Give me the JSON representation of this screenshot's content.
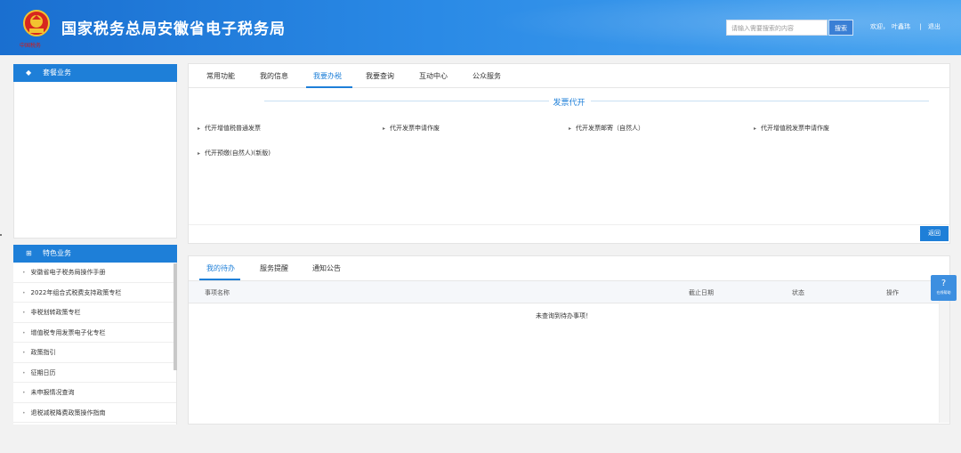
{
  "header": {
    "title": "国家税务总局安徽省电子税务局",
    "emblem_caption": "中国税务",
    "search_placeholder": "请输入需要搜索的内容",
    "search_button": "搜索",
    "welcome": "欢迎，",
    "user_name": "叶鑫玮",
    "separator": "|",
    "logout": "退出",
    "colors": {
      "brand": "#1e7fd8",
      "header_start": "#1a6fd0",
      "header_end": "#4aa5f0"
    }
  },
  "sidebar": {
    "package_title": "套餐业务",
    "package_icon": "layers-icon",
    "featured_title": "特色业务",
    "featured_icon": "grid-icon",
    "featured_items": [
      "安徽省电子税务局操作手册",
      "2022年组合式税费支持政策专栏",
      "非税划转政策专栏",
      "增值税专用发票电子化专栏",
      "政策指引",
      "征期日历",
      "未申报情况查询",
      "退税减税降费政策操作指南"
    ]
  },
  "main": {
    "tabs": [
      "常用功能",
      "我的信息",
      "我要办税",
      "我要查询",
      "互动中心",
      "公众服务"
    ],
    "active_tab": "我要办税",
    "section_title": "发票代开",
    "invoice_links": [
      "代开增值税普通发票",
      "代开发票申请作废",
      "代开发票邮寄（自然人）",
      "代开增值税发票申请作废",
      "代开预缴(自然人)(新版)"
    ],
    "return_button": "返回"
  },
  "todo": {
    "tabs": [
      "我的待办",
      "服务提醒",
      "通知公告"
    ],
    "active_tab": "我的待办",
    "columns": [
      "事项名称",
      "截止日期",
      "状态",
      "操作"
    ],
    "empty_message": "未查询到待办事项！"
  },
  "float_service": {
    "icon": "question-icon",
    "label": "在线帮助"
  }
}
